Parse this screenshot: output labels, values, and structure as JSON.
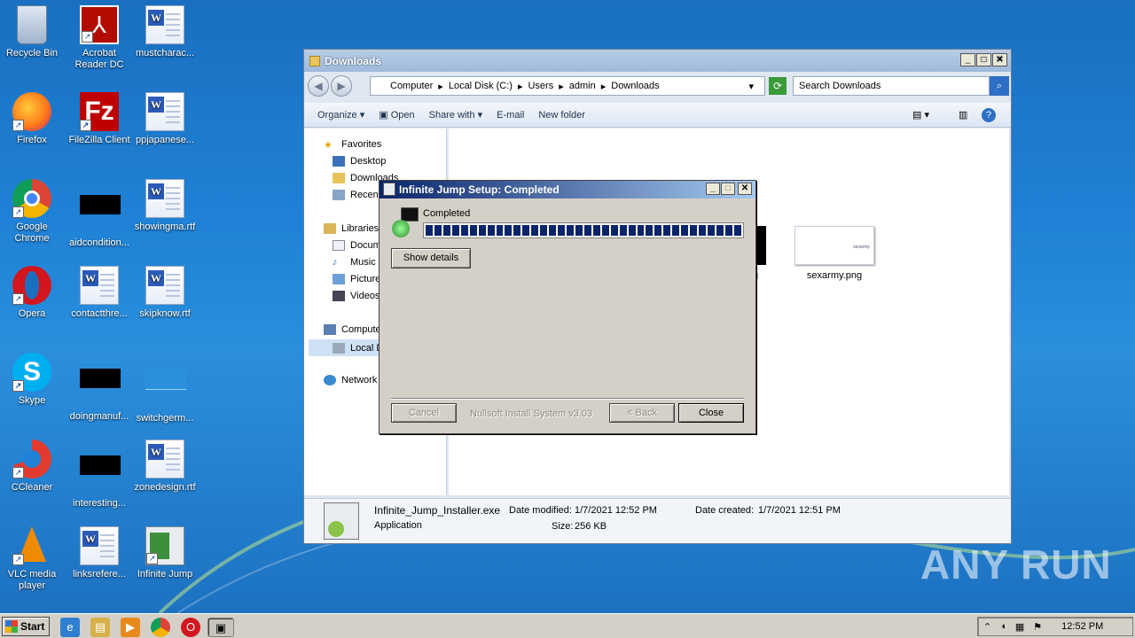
{
  "desktop": {
    "icons": [
      {
        "label": "Recycle Bin"
      },
      {
        "label": "Acrobat Reader DC"
      },
      {
        "label": "mustcharac..."
      },
      {
        "label": "Firefox"
      },
      {
        "label": "FileZilla Client"
      },
      {
        "label": "ppjapanese..."
      },
      {
        "label": "Google Chrome"
      },
      {
        "label": "aidcondition..."
      },
      {
        "label": "showingma.rtf"
      },
      {
        "label": "Opera"
      },
      {
        "label": "contactthre..."
      },
      {
        "label": "skipknow.rtf"
      },
      {
        "label": "Skype"
      },
      {
        "label": "doingmanuf..."
      },
      {
        "label": "switchgerm..."
      },
      {
        "label": "CCleaner"
      },
      {
        "label": "interesting..."
      },
      {
        "label": "zonedesign.rtf"
      },
      {
        "label": "VLC media player"
      },
      {
        "label": "linksrefere..."
      },
      {
        "label": "Infinite Jump"
      }
    ]
  },
  "explorer": {
    "title": "Downloads",
    "address": [
      "Computer",
      "Local Disk (C:)",
      "Users",
      "admin",
      "Downloads"
    ],
    "search_placeholder": "Search Downloads",
    "toolbar": {
      "organize": "Organize",
      "open": "Open",
      "share": "Share with",
      "email": "E-mail",
      "new_folder": "New folder"
    },
    "nav": {
      "favorites": "Favorites",
      "desktop": "Desktop",
      "downloads": "Downloads",
      "recent": "Recen",
      "libraries": "Libraries",
      "documents": "Docum",
      "music": "Music",
      "pictures": "Picture",
      "videos": "Videos",
      "computer": "Compute",
      "local_disk": "Local D",
      "network": "Network"
    },
    "files": [
      {
        "name": "sexarmy.png",
        "thumb_text": "sexarmy"
      },
      {
        "name": "g"
      }
    ],
    "details": {
      "filename": "Infinite_Jump_Installer.exe",
      "type": "Application",
      "modified_label": "Date modified:",
      "modified": "1/7/2021 12:52 PM",
      "created_label": "Date created:",
      "created": "1/7/2021 12:51 PM",
      "size_label": "Size:",
      "size": "256 KB"
    }
  },
  "dialog": {
    "title": "Infinite Jump Setup: Completed",
    "status": "Completed",
    "progress": 1.0,
    "show_details": "Show details",
    "cancel": "Cancel",
    "branding": "Nullsoft Install System v3.03",
    "back": "< Back",
    "close": "Close"
  },
  "taskbar": {
    "start": "Start",
    "clock": "12:52 PM"
  },
  "watermark": "ANY RUN"
}
